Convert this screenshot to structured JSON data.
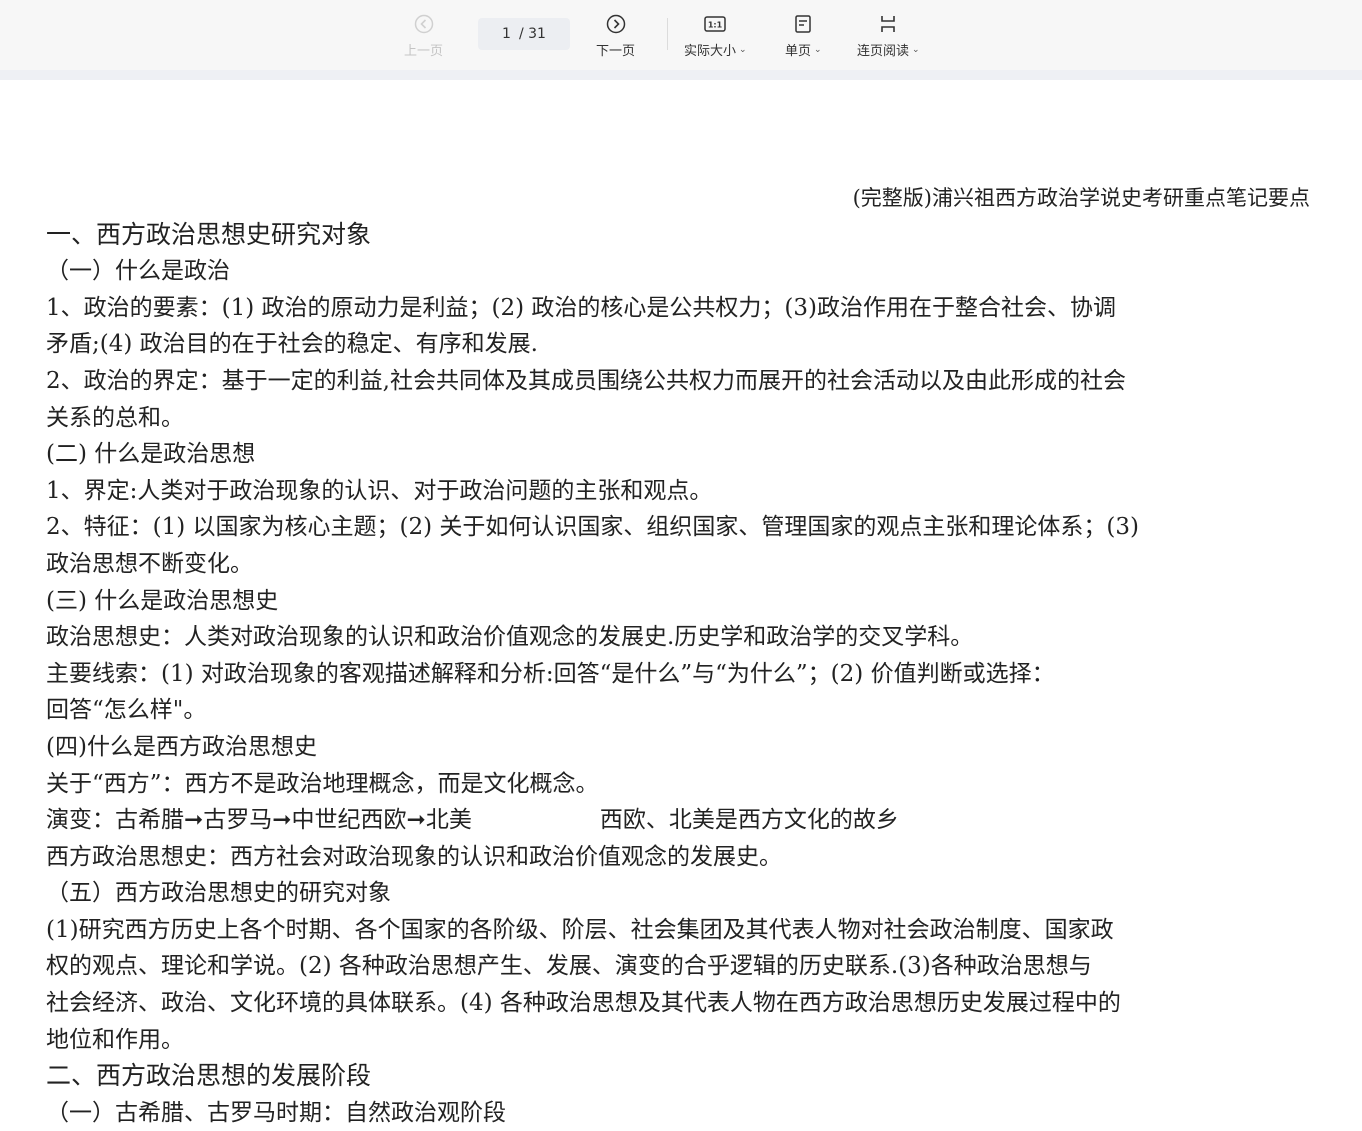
{
  "toolbar": {
    "prev_label": "上一页",
    "current_page": "1",
    "total_pages": "/ 31",
    "next_label": "下一页",
    "actual_size_label": "实际大小",
    "single_page_label": "单页",
    "continuous_label": "连页阅读",
    "actual_size_icon_text": "1:1"
  },
  "document": {
    "title": "(完整版)浦兴祖西方政治学说史考研重点笔记要点",
    "lines": [
      "一、西方政治思想史研究对象",
      "（一）什么是政治",
      "1、政治的要素：(1) 政治的原动力是利益；(2) 政治的核心是公共权力；(3)政治作用在于整合社会、协调",
      "矛盾;(4) 政治目的在于社会的稳定、有序和发展.",
      "2、政治的界定：基于一定的利益,社会共同体及其成员围绕公共权力而展开的社会活动以及由此形成的社会",
      "关系的总和。",
      "(二) 什么是政治思想",
      "1、界定:人类对于政治现象的认识、对于政治问题的主张和观点。",
      "2、特征：(1) 以国家为核心主题；(2) 关于如何认识国家、组织国家、管理国家的观点主张和理论体系；(3)",
      "政治思想不断变化。",
      "(三) 什么是政治思想史",
      "政治思想史：人类对政治现象的认识和政治价值观念的发展史.历史学和政治学的交叉学科。",
      "主要线索：(1) 对政治现象的客观描述解释和分析:回答“是什么”与“为什么”；(2) 价值判断或选择：",
      "回答“怎么样\"。",
      "(四)什么是西方政治思想史",
      "关于“西方”：西方不是政治地理概念，而是文化概念。",
      "演变：古希腊➞古罗马➞中世纪西欧➞北美",
      "西欧、北美是西方文化的故乡",
      "西方政治思想史：西方社会对政治现象的认识和政治价值观念的发展史。",
      "（五）西方政治思想史的研究对象",
      "(1)研究西方历史上各个时期、各个国家的各阶级、阶层、社会集团及其代表人物对社会政治制度、国家政",
      "权的观点、理论和学说。(2) 各种政治思想产生、发展、演变的合乎逻辑的历史联系.(3)各种政治思想与",
      "社会经济、政治、文化环境的具体联系。(4) 各种政治思想及其代表人物在西方政治思想历史发展过程中的",
      "地位和作用。",
      "二、西方政治思想的发展阶段",
      "（一）古希腊、古罗马时期：自然政治观阶段"
    ]
  }
}
